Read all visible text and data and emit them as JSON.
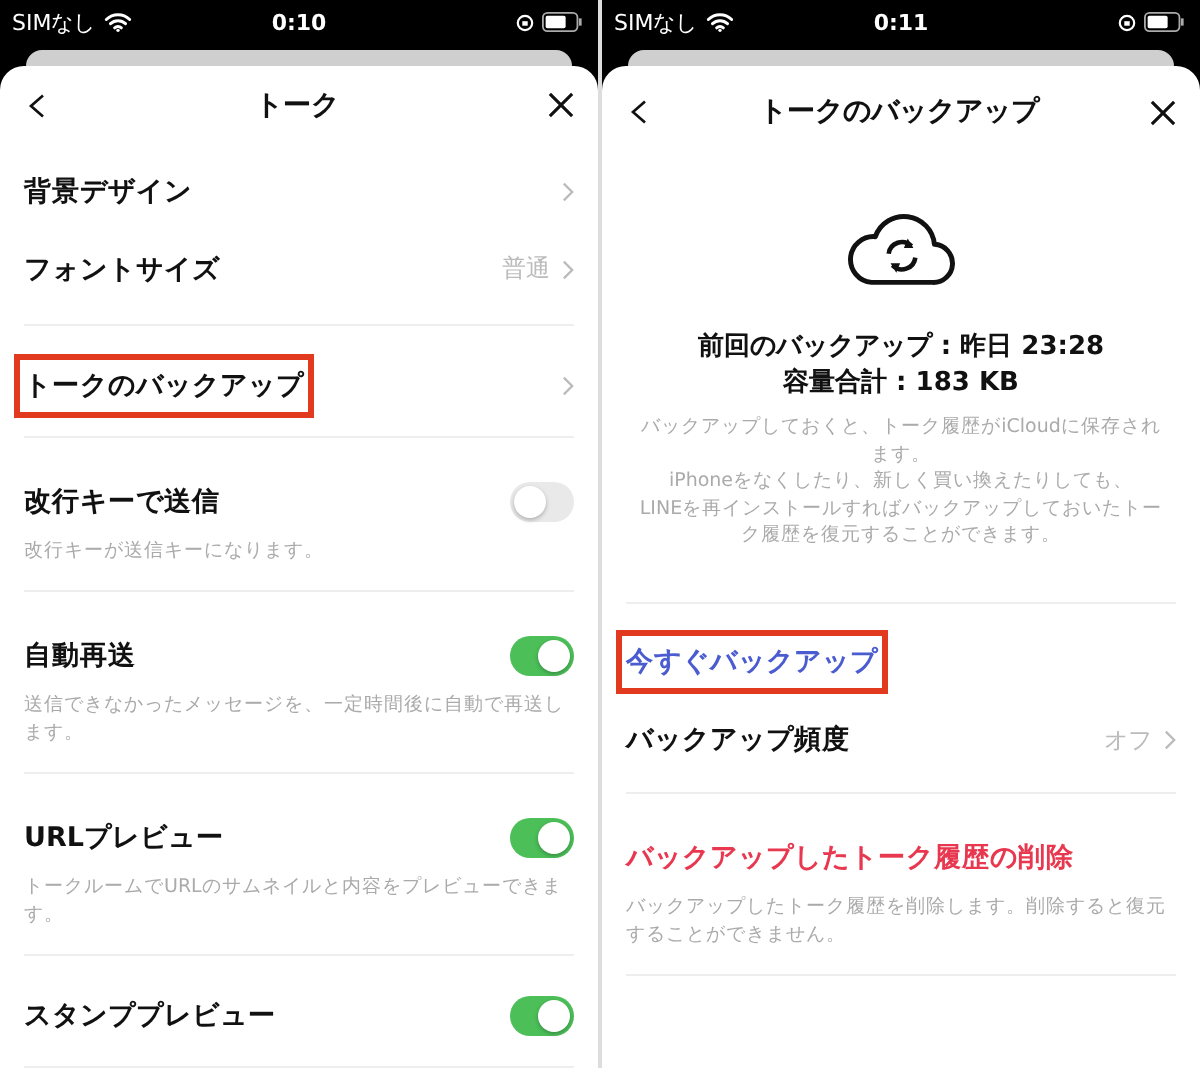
{
  "screens": [
    {
      "status_bar": {
        "carrier": "SIMなし",
        "time": "0:10"
      },
      "title": "トーク",
      "sections": [
        {
          "items": [
            {
              "kind": "nav",
              "label": "背景デザイン",
              "highlighted": false
            },
            {
              "kind": "nav",
              "label": "フォントサイズ",
              "value": "普通",
              "highlighted": false
            }
          ]
        },
        {
          "items": [
            {
              "kind": "nav",
              "label": "トークのバックアップ",
              "highlighted": true
            }
          ]
        },
        {
          "items": [
            {
              "kind": "toggle",
              "label": "改行キーで送信",
              "on": false,
              "description": "改行キーが送信キーになります。",
              "highlighted": false
            }
          ]
        },
        {
          "items": [
            {
              "kind": "toggle",
              "label": "自動再送",
              "on": true,
              "description": "送信できなかったメッセージを、一定時間後に自動で再送します。",
              "highlighted": false
            }
          ]
        },
        {
          "items": [
            {
              "kind": "toggle",
              "label": "URLプレビュー",
              "on": true,
              "description": "トークルームでURLのサムネイルと内容をプレビューできます。",
              "highlighted": false
            }
          ]
        },
        {
          "items": [
            {
              "kind": "toggle",
              "label": "スタンププレビュー",
              "on": true,
              "highlighted": false
            }
          ]
        }
      ]
    },
    {
      "status_bar": {
        "carrier": "SIMなし",
        "time": "0:11"
      },
      "title": "トークのバックアップ",
      "summary": {
        "lines": [
          "前回のバックアップ : 昨日 23:28",
          "容量合計 : 183 KB"
        ],
        "description": "バックアップしておくと、トーク履歴がiCloudに保存されます。\niPhoneをなくしたり、新しく買い換えたりしても、\nLINEを再インストールすればバックアップしておいたトーク履歴を復元することができます。"
      },
      "sections": [
        {
          "items": [
            {
              "kind": "link",
              "label": "今すぐバックアップ",
              "highlighted": true
            },
            {
              "kind": "nav",
              "label": "バックアップ頻度",
              "value": "オフ",
              "highlighted": false
            }
          ]
        },
        {
          "items": [
            {
              "kind": "danger",
              "label": "バックアップしたトーク履歴の削除",
              "description": "バックアップしたトーク履歴を削除します。削除すると復元することができません。",
              "highlighted": false
            }
          ]
        }
      ]
    }
  ]
}
